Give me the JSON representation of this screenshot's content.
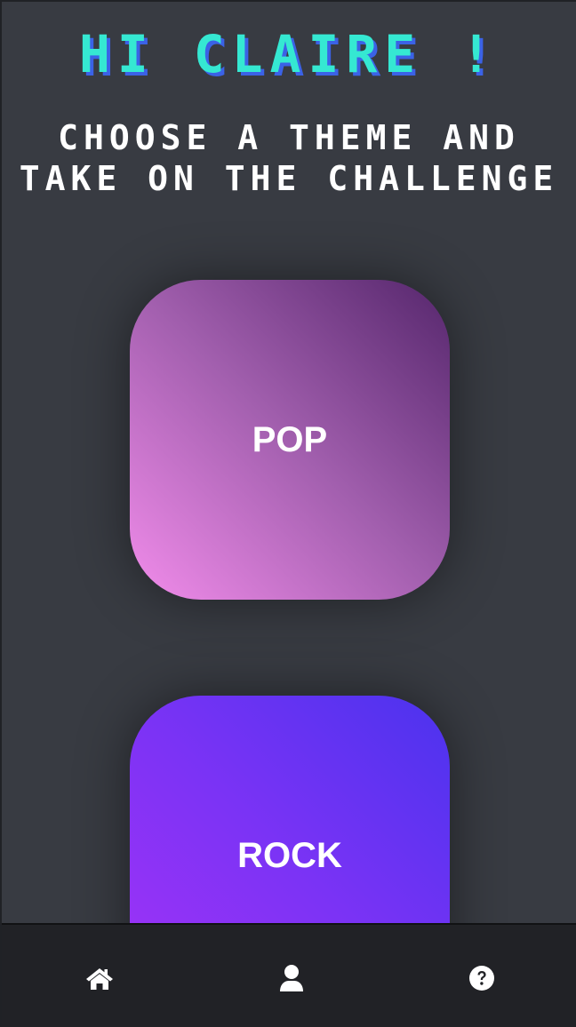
{
  "header": {
    "greeting": "HI CLAIRE !",
    "subtitle_line1": "CHOOSE A THEME AND",
    "subtitle_line2": "TAKE ON THE CHALLENGE"
  },
  "themes": [
    {
      "label": "POP",
      "gradient": [
        "#f28ceb",
        "#55266c"
      ]
    },
    {
      "label": "ROCK",
      "gradient": [
        "#a233f6",
        "#4b33ee"
      ]
    }
  ],
  "bottom_nav": {
    "items": [
      {
        "icon": "home-icon"
      },
      {
        "icon": "user-icon"
      },
      {
        "icon": "help-icon"
      }
    ]
  },
  "colors": {
    "background": "#383b42",
    "nav_background": "#212226",
    "greeting": "#35e8d2",
    "greeting_shadow": "#3b62e6",
    "text": "#ffffff"
  }
}
